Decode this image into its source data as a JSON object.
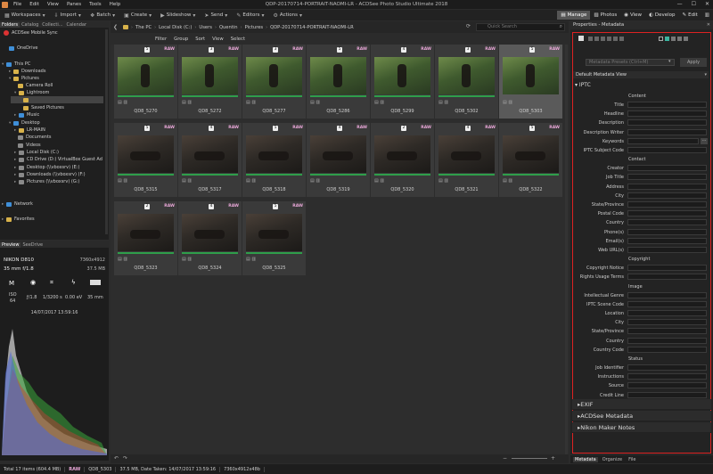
{
  "titlebar": {
    "menus": [
      "File",
      "Edit",
      "View",
      "Panes",
      "Tools",
      "Help"
    ],
    "title": "QDP-20170714-PORTRAIT-NAOMI-LR - ACDSee Photo Studio Ultimate 2018"
  },
  "toolbar": {
    "workspaces": "Workspaces",
    "import": "Import",
    "batch": "Batch",
    "create": "Create",
    "slideshow": "Slideshow",
    "send": "Send",
    "editors": "Editors",
    "actions": "Actions",
    "modes": [
      "Manage",
      "Photos",
      "View",
      "Develop",
      "Edit"
    ]
  },
  "left_tabs": [
    "Folders",
    "Catalog",
    "Collecti...",
    "Calendar"
  ],
  "mobile_sync": "ACDSee Mobile Sync",
  "tree": [
    {
      "label": "OneDrive",
      "icon": "onedrive-icon"
    },
    {
      "label": "This PC",
      "icon": "computer-icon"
    },
    {
      "label": "Downloads",
      "icon": "folder-icon"
    },
    {
      "label": "Pictures",
      "icon": "folder-icon"
    },
    {
      "label": "Camera Roll",
      "icon": "folder-icon"
    },
    {
      "label": "Lightroom",
      "icon": "folder-icon"
    },
    {
      "label": "",
      "icon": "folder-icon"
    },
    {
      "label": "Saved Pictures",
      "icon": "folder-icon"
    },
    {
      "label": "Music",
      "icon": "music-icon"
    },
    {
      "label": "Desktop",
      "icon": "desktop-icon"
    },
    {
      "label": "LR-MAIN",
      "icon": "folder-icon"
    },
    {
      "label": "Documents",
      "icon": "documents-icon"
    },
    {
      "label": "Videos",
      "icon": "videos-icon"
    },
    {
      "label": "Local Disk (C:)",
      "icon": "drive-icon"
    },
    {
      "label": "CD Drive (D:) VirtualBox Guest Ad",
      "icon": "cd-drive-icon"
    },
    {
      "label": "Desktop (\\\\vboxsrv) (E:)",
      "icon": "network-drive-icon"
    },
    {
      "label": "Downloads (\\\\vboxsrv) (F:)",
      "icon": "network-drive-icon"
    },
    {
      "label": "Pictures (\\\\vboxsrv) (G:)",
      "icon": "network-drive-icon"
    },
    {
      "label": "Network",
      "icon": "network-icon"
    },
    {
      "label": "Favorites",
      "icon": "favorites-icon"
    }
  ],
  "preview": {
    "tabs": [
      "Preview",
      "SeeDrive"
    ],
    "camera": "NIKON D810",
    "dimensions": "7360x4912",
    "lens": "35 mm f/1.8",
    "size": "37.5 MB",
    "mode": "M",
    "iso_label": "ISO",
    "iso_value": "64",
    "aperture": "ƒ/1.8",
    "shutter": "1/3200 s",
    "ev": "0.00 eV",
    "focal": "35 mm",
    "datetime": "14/07/2017 13:59:16"
  },
  "pathbar": {
    "crumbs": [
      "The PC",
      "Local Disk (C:)",
      "Users",
      "Quentin",
      "Pictures",
      "QDP-20170714-PORTRAIT-NAOMI-LR"
    ],
    "search_placeholder": "Quick Search"
  },
  "filterbar": [
    "Filter",
    "Group",
    "Sort",
    "View",
    "Select"
  ],
  "files": [
    {
      "name": "QD8_5270",
      "rating": "5",
      "raw": "RAW"
    },
    {
      "name": "QD8_5272",
      "rating": "3",
      "raw": "RAW"
    },
    {
      "name": "QD8_5277",
      "rating": "3",
      "raw": "RAW"
    },
    {
      "name": "QD8_5286",
      "rating": "5",
      "raw": "RAW"
    },
    {
      "name": "QD8_5299",
      "rating": "4",
      "raw": "RAW"
    },
    {
      "name": "QD8_5302",
      "rating": "3",
      "raw": "RAW"
    },
    {
      "name": "QD8_5303",
      "rating": "5",
      "raw": "RAW"
    },
    {
      "name": "QD8_5315",
      "rating": "5",
      "raw": "RAW"
    },
    {
      "name": "QD8_5317",
      "rating": "4",
      "raw": "RAW"
    },
    {
      "name": "QD8_5318",
      "rating": "5",
      "raw": "RAW"
    },
    {
      "name": "QD8_5319",
      "rating": "4",
      "raw": "RAW"
    },
    {
      "name": "QD8_5320",
      "rating": "2",
      "raw": "RAW"
    },
    {
      "name": "QD8_5321",
      "rating": "4",
      "raw": "RAW"
    },
    {
      "name": "QD8_5322",
      "rating": "5",
      "raw": "RAW"
    },
    {
      "name": "QD8_5323",
      "rating": "2",
      "raw": "RAW"
    },
    {
      "name": "QD8_5324",
      "rating": "4",
      "raw": "RAW"
    },
    {
      "name": "QD8_5325",
      "rating": "5",
      "raw": "RAW"
    }
  ],
  "properties": {
    "title": "Properties - Metadata",
    "presets_placeholder": "Metadata Presets (Ctrl+M)",
    "apply": "Apply",
    "view": "Default Metadata View",
    "iptc": "IPTC",
    "sections": {
      "content": "Content",
      "contact": "Contact",
      "copyright": "Copyright",
      "image": "Image",
      "status": "Status"
    },
    "content_fields": [
      "Title",
      "Headline",
      "Description",
      "Description Writer",
      "Keywords",
      "IPTC Subject Code"
    ],
    "contact_fields": [
      "Creator",
      "Job Title",
      "Address",
      "City",
      "State/Province",
      "Postal Code",
      "Country",
      "Phone(s)",
      "Email(s)",
      "Web URL(s)"
    ],
    "copyright_fields": [
      "Copyright Notice",
      "Rights Usage Terms"
    ],
    "image_fields": [
      "Intellectual Genre",
      "IPTC Scene Code",
      "Location",
      "City",
      "State/Province",
      "Country",
      "Country Code"
    ],
    "status_fields": [
      "Job Identifier",
      "Instructions",
      "Source",
      "Credit Line"
    ],
    "collapsed": [
      "EXIF",
      "ACDSee Metadata",
      "Nikon Maker Notes"
    ],
    "bottom_tabs": [
      "Metadata",
      "Organize",
      "File"
    ]
  },
  "status": {
    "total": "Total 17 items (604.4 MB)",
    "raw": "RAW",
    "file": "QD8_5303",
    "info": "37.5 MB, Date Taken: 14/07/2017 13:59:16",
    "dims": "7360x4912x48b"
  }
}
